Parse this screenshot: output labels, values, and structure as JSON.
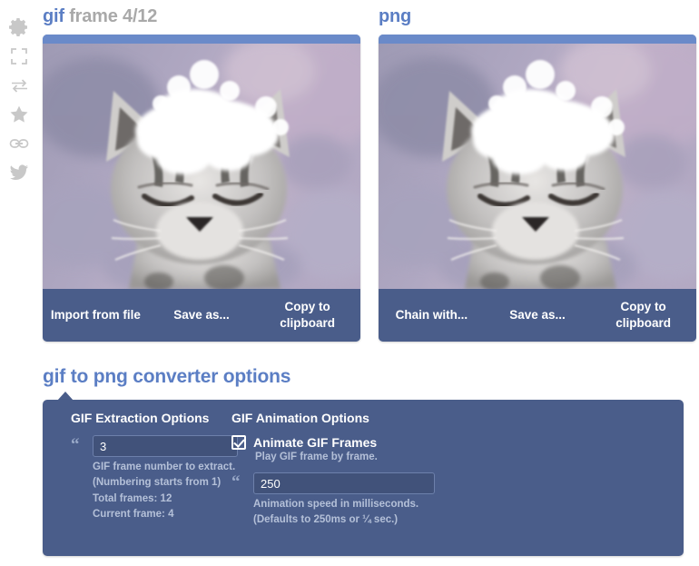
{
  "theme": {
    "accent": "#5b7ec4",
    "panel_bg": "#4a5d8a",
    "input_bg": "#41527a",
    "hint_color": "#b4c0d8",
    "title_muted": "#a9a9a9",
    "rail_icon": "#c8c8c8"
  },
  "rail": {
    "items": [
      {
        "icon": "gear-icon"
      },
      {
        "icon": "fullscreen-icon"
      },
      {
        "icon": "swap-arrows-icon"
      },
      {
        "icon": "star-icon"
      },
      {
        "icon": "link-icon"
      },
      {
        "icon": "twitter-icon"
      }
    ]
  },
  "cards": [
    {
      "format": "gif",
      "title_rest": " frame 4/12",
      "image_alt": "cat with snow on its head",
      "buttons": [
        "Import from file",
        "Save as...",
        "Copy to clipboard"
      ]
    },
    {
      "format": "png",
      "title_rest": "",
      "image_alt": "cat with snow on its head",
      "buttons": [
        "Chain with...",
        "Save as...",
        "Copy to clipboard"
      ]
    }
  ],
  "options": {
    "section_title": "gif to png converter options",
    "extraction": {
      "heading": "GIF Extraction Options",
      "frame_number_value": "3",
      "frame_number_placeholder": "",
      "hints": [
        "GIF frame number to extract.",
        "(Numbering starts from 1)",
        "Total frames: 12",
        "Current frame: 4"
      ]
    },
    "animation": {
      "heading": "GIF Animation Options",
      "animate_label": "Animate GIF Frames",
      "animate_checked": true,
      "animate_hint": "Play GIF frame by frame.",
      "speed_value": "250",
      "speed_placeholder": "",
      "speed_hints": [
        "Animation speed in milliseconds.",
        "(Defaults to 250ms or ¼ sec.)"
      ]
    }
  }
}
